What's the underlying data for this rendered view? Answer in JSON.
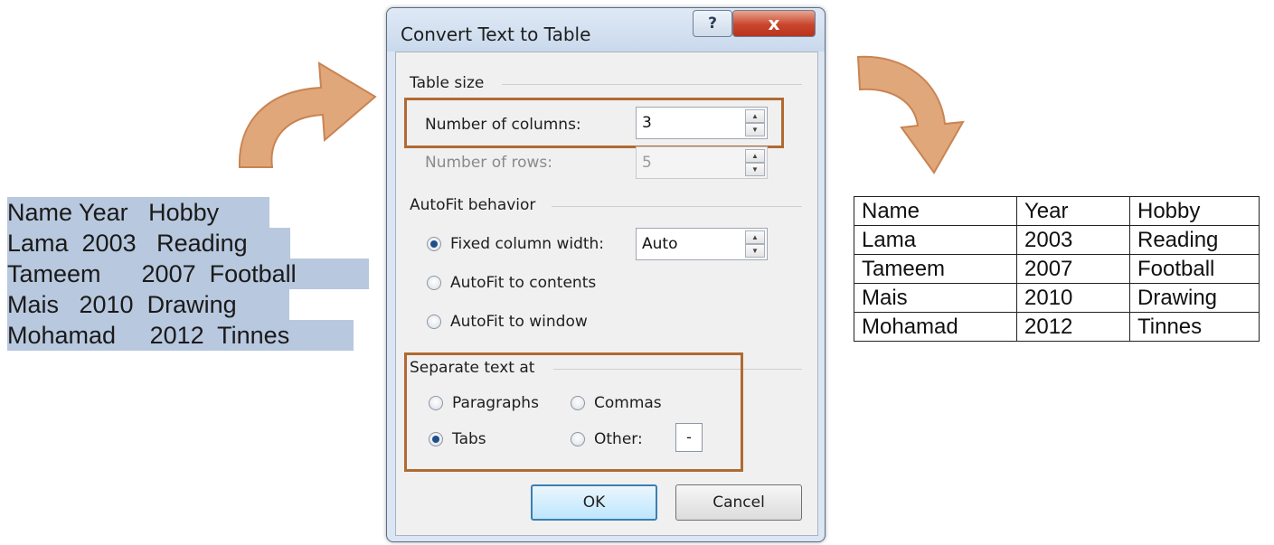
{
  "source_text": {
    "lines": [
      "Name Year   Hobby",
      "Lama  2003   Reading",
      "Tameem      2007  Football",
      "Mais   2010  Drawing",
      "Mohamad     2012  Tinnes"
    ]
  },
  "dialog": {
    "title": "Convert Text to Table",
    "help_glyph": "?",
    "close_glyph": "x",
    "table_size": {
      "heading": "Table size",
      "columns_label": "Number of columns:",
      "columns_value": "3",
      "rows_label": "Number of rows:",
      "rows_value": "5"
    },
    "autofit": {
      "heading": "AutoFit behavior",
      "options": [
        {
          "label": "Fixed column width:",
          "checked": true
        },
        {
          "label": "AutoFit to contents",
          "checked": false
        },
        {
          "label": "AutoFit to window",
          "checked": false
        }
      ],
      "fixed_width_value": "Auto"
    },
    "separate": {
      "heading": "Separate text at",
      "options": [
        {
          "label": "Paragraphs",
          "checked": false
        },
        {
          "label": "Commas",
          "checked": false
        },
        {
          "label": "Tabs",
          "checked": true
        },
        {
          "label": "Other:",
          "checked": false
        }
      ],
      "other_value": "-"
    },
    "ok_label": "OK",
    "cancel_label": "Cancel"
  },
  "result_table": {
    "rows": [
      [
        "Name",
        "Year",
        "Hobby"
      ],
      [
        "Lama",
        "2003",
        "Reading"
      ],
      [
        "Tameem",
        "2007",
        "Football"
      ],
      [
        "Mais",
        "2010",
        "Drawing"
      ],
      [
        "Mohamad",
        "2012",
        "Tinnes"
      ]
    ]
  },
  "colors": {
    "selection": "#b8c8de",
    "arrow": "#e0a77a",
    "highlight_border": "#b06a32"
  },
  "icons": [
    "arrow-curved-right-icon",
    "arrow-curved-down-icon",
    "help-icon",
    "close-icon",
    "spin-up-icon",
    "spin-down-icon"
  ]
}
